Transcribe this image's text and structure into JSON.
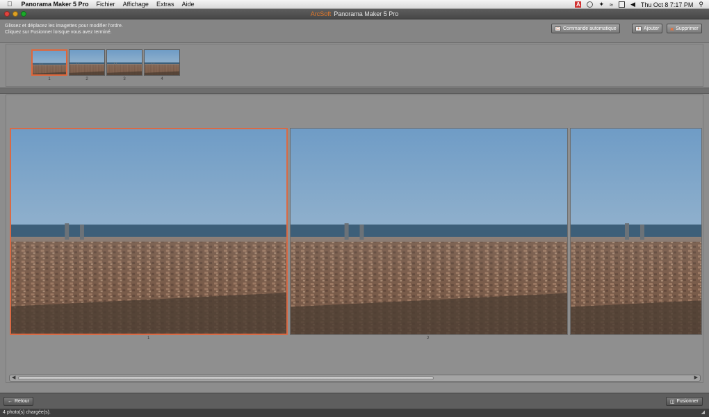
{
  "menubar": {
    "apple_icon": "apple-logo-icon",
    "items": [
      "Panorama Maker 5 Pro",
      "Fichier",
      "Affichage",
      "Extras",
      "Aide"
    ],
    "status_icons": [
      "text-input-icon",
      "time-machine-icon",
      "bluetooth-icon",
      "wifi-icon",
      "display-icon",
      "volume-icon"
    ],
    "clock": "Thu Oct 8  7:17 PM",
    "search_icon": "spotlight-search-icon"
  },
  "window": {
    "brand": "ArcSoft",
    "title": "Panorama Maker 5 Pro"
  },
  "toolbar": {
    "instructions_line1": "Glissez et déplacez les imagettes pour modifier l'ordre.",
    "instructions_line2": "Cliquez sur Fusionner lorsque vous avez terminé.",
    "auto_arrange_label": "Commande automatique",
    "add_label": "Ajouter",
    "delete_label": "Supprimer"
  },
  "thumbnails": [
    {
      "number": "1",
      "selected": true
    },
    {
      "number": "2",
      "selected": false
    },
    {
      "number": "3",
      "selected": false
    },
    {
      "number": "4",
      "selected": false
    }
  ],
  "preview": {
    "photos": [
      {
        "label": "1",
        "selected": true
      },
      {
        "label": "2",
        "selected": false
      },
      {
        "label": "",
        "selected": false
      }
    ],
    "scroll_position": 0.0
  },
  "bottom": {
    "back_label": "Retour",
    "merge_label": "Fusionner"
  },
  "statusbar": {
    "text": "4 photo(s) chargée(s)."
  },
  "colors": {
    "accent": "#e0663a",
    "sky": "#8fb1cf",
    "sea": "#3d5f79",
    "city": "#8a6a55"
  }
}
